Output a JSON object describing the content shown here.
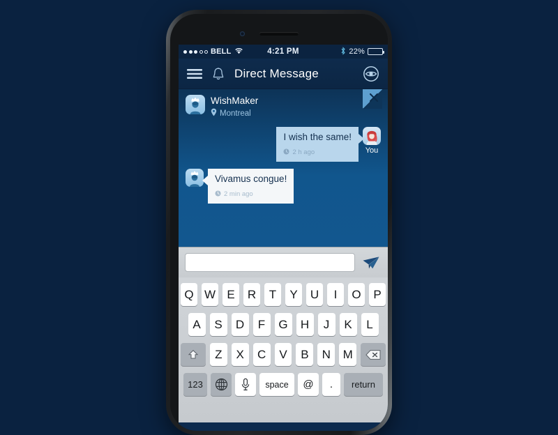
{
  "status_bar": {
    "signal_dots_filled": 3,
    "signal_dots_empty": 2,
    "carrier": "BELL",
    "wifi_icon": "wifi-icon",
    "time": "4:21 PM",
    "bluetooth_icon": "bluetooth-icon",
    "battery_percent": "22%",
    "battery_level": 22
  },
  "nav_bar": {
    "menu_icon": "hamburger-menu-icon",
    "bell_icon": "bell-icon",
    "title": "Direct Message",
    "eye_icon": "eye-icon"
  },
  "conversation": {
    "peer": {
      "name": "WishMaker",
      "location": "Montreal",
      "location_icon": "map-pin-icon",
      "avatar": "crowned-user-avatar"
    },
    "close_label": "×",
    "you_label": "You",
    "messages": [
      {
        "direction": "outgoing",
        "text": "I wish the same!",
        "time": "2 h ago",
        "time_icon": "clock-icon",
        "avatar": "red-haired-user-avatar"
      },
      {
        "direction": "incoming",
        "text": "Vivamus congue!",
        "time": "2 min ago",
        "time_icon": "clock-icon",
        "avatar": "crowned-user-avatar"
      }
    ]
  },
  "input_bar": {
    "value": "",
    "placeholder": "",
    "send_icon": "paper-plane-send-icon"
  },
  "keyboard": {
    "row1": [
      "Q",
      "W",
      "E",
      "R",
      "T",
      "Y",
      "U",
      "I",
      "O",
      "P"
    ],
    "row2": [
      "A",
      "S",
      "D",
      "F",
      "G",
      "H",
      "J",
      "K",
      "L"
    ],
    "row3": [
      "Z",
      "X",
      "C",
      "V",
      "B",
      "N",
      "M"
    ],
    "shift_icon": "shift-arrow-icon",
    "backspace_icon": "backspace-delete-icon",
    "numbers_key": "123",
    "globe_icon": "globe-language-icon",
    "mic_icon": "microphone-icon",
    "space_key": "space",
    "at_key": "@",
    "period_key": ".",
    "return_key": "return"
  },
  "colors": {
    "page_background": "#0a2240",
    "chat_background": "#11568d",
    "nav_background": "#0c2644",
    "sent_bubble": "#b9d6ec",
    "received_bubble": "#f4f7f9",
    "text_dark": "#14304f",
    "accent_light_blue": "#5d9fd0"
  }
}
